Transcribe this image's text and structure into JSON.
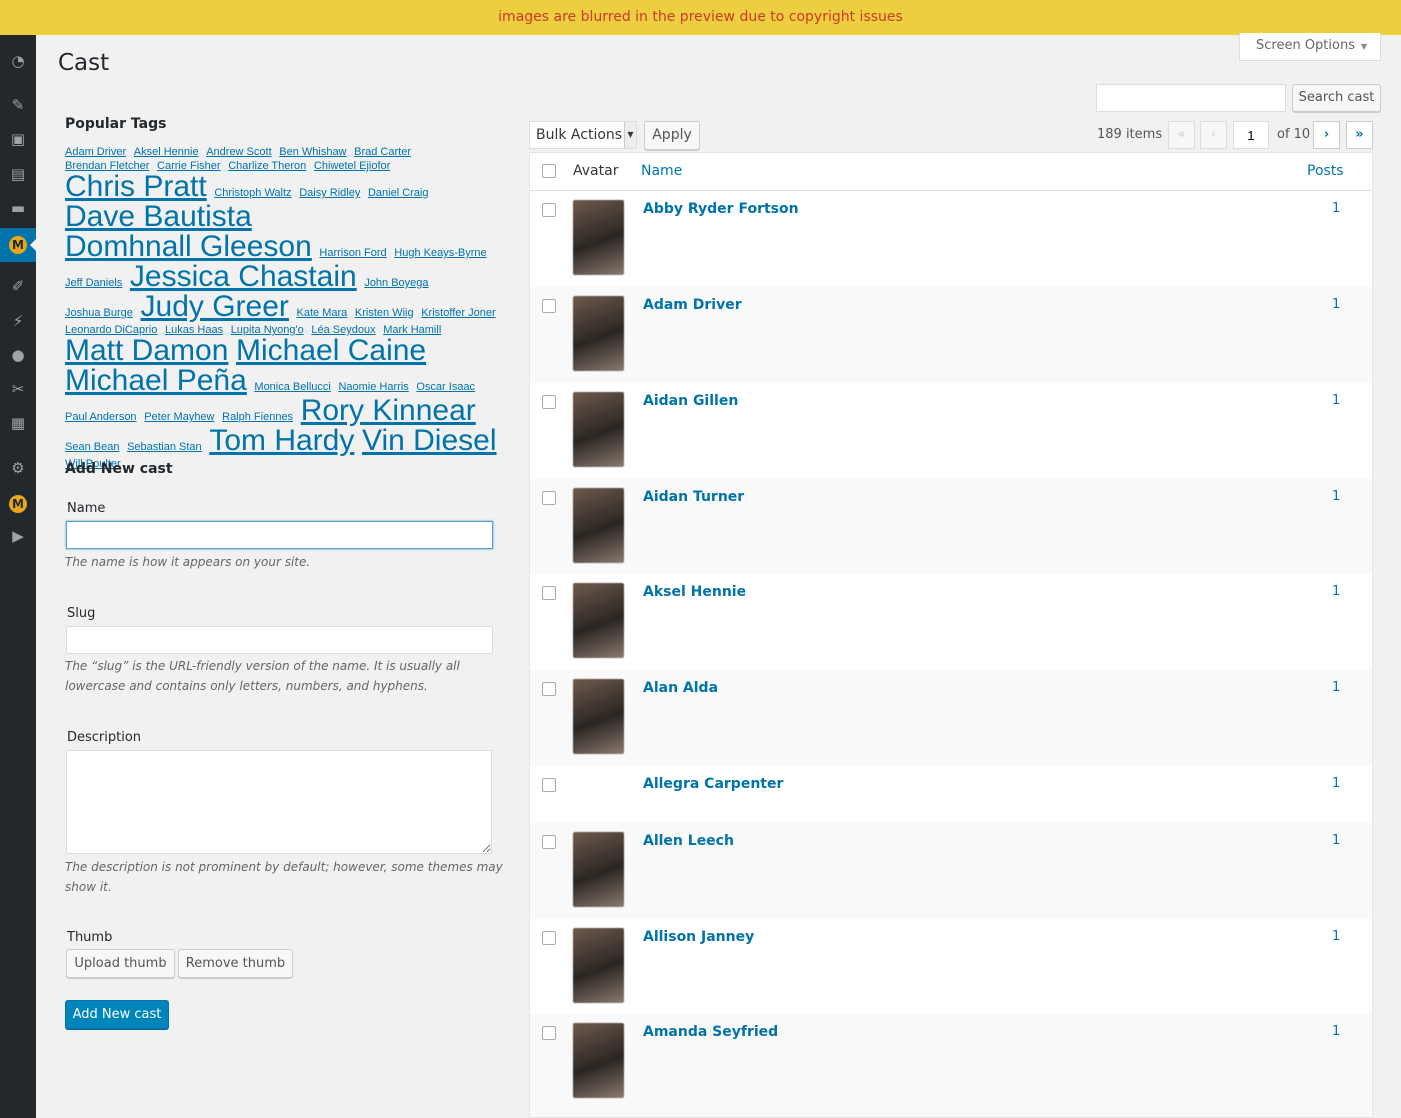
{
  "banner": "images are blurred in the preview due to copyright issues",
  "screen_options": "Screen Options",
  "page_title": "Cast",
  "search": {
    "placeholder": "",
    "button": "Search cast"
  },
  "popular_tags": {
    "title": "Popular Tags",
    "tags": [
      {
        "label": "Adam Driver",
        "size": "small"
      },
      {
        "label": "Aksel Hennie",
        "size": "small"
      },
      {
        "label": "Andrew Scott",
        "size": "small"
      },
      {
        "label": "Ben Whishaw",
        "size": "small"
      },
      {
        "label": "Brad Carter",
        "size": "small"
      },
      {
        "label": "Brendan Fletcher",
        "size": "small"
      },
      {
        "label": "Carrie Fisher",
        "size": "small"
      },
      {
        "label": "Charlize Theron",
        "size": "small"
      },
      {
        "label": "Chiwetel Ejiofor",
        "size": "small"
      },
      {
        "label": "Chris Pratt",
        "size": "large"
      },
      {
        "label": "Christoph Waltz",
        "size": "small"
      },
      {
        "label": "Daisy Ridley",
        "size": "small"
      },
      {
        "label": "Daniel Craig",
        "size": "small"
      },
      {
        "label": "Dave Bautista",
        "size": "large"
      },
      {
        "label": "Domhnall Gleeson",
        "size": "large"
      },
      {
        "label": "Harrison Ford",
        "size": "small"
      },
      {
        "label": "Hugh Keays-Byrne",
        "size": "small"
      },
      {
        "label": "Jeff Daniels",
        "size": "small"
      },
      {
        "label": "Jessica Chastain",
        "size": "large"
      },
      {
        "label": "John Boyega",
        "size": "small"
      },
      {
        "label": "Joshua Burge",
        "size": "small"
      },
      {
        "label": "Judy Greer",
        "size": "large"
      },
      {
        "label": "Kate Mara",
        "size": "small"
      },
      {
        "label": "Kristen Wiig",
        "size": "small"
      },
      {
        "label": "Kristoffer Joner",
        "size": "small"
      },
      {
        "label": "Leonardo DiCaprio",
        "size": "small"
      },
      {
        "label": "Lukas Haas",
        "size": "small"
      },
      {
        "label": "Lupita Nyong'o",
        "size": "small"
      },
      {
        "label": "Léa Seydoux",
        "size": "small"
      },
      {
        "label": "Mark Hamill",
        "size": "small"
      },
      {
        "label": "Matt Damon",
        "size": "large"
      },
      {
        "label": "Michael Caine",
        "size": "large"
      },
      {
        "label": "Michael Peña",
        "size": "large"
      },
      {
        "label": "Monica Bellucci",
        "size": "small"
      },
      {
        "label": "Naomie Harris",
        "size": "small"
      },
      {
        "label": "Oscar Isaac",
        "size": "small"
      },
      {
        "label": "Paul Anderson",
        "size": "small"
      },
      {
        "label": "Peter Mayhew",
        "size": "small"
      },
      {
        "label": "Ralph Fiennes",
        "size": "small"
      },
      {
        "label": "Rory Kinnear",
        "size": "large"
      },
      {
        "label": "Sean Bean",
        "size": "small"
      },
      {
        "label": "Sebastian Stan",
        "size": "small"
      },
      {
        "label": "Tom Hardy",
        "size": "large"
      },
      {
        "label": "Vin Diesel",
        "size": "large"
      },
      {
        "label": "Will Poulter",
        "size": "small"
      }
    ]
  },
  "add_form": {
    "title": "Add New cast",
    "name_label": "Name",
    "name_value": "",
    "name_help": "The name is how it appears on your site.",
    "slug_label": "Slug",
    "slug_value": "",
    "slug_help": "The “slug” is the URL-friendly version of the name. It is usually all lowercase and contains only letters, numbers, and hyphens.",
    "description_label": "Description",
    "description_value": "",
    "description_help": "The description is not prominent by default; however, some themes may show it.",
    "thumb_label": "Thumb",
    "upload_button": "Upload thumb",
    "remove_button": "Remove thumb",
    "submit_button": "Add New cast"
  },
  "list": {
    "bulk_actions": "Bulk Actions",
    "apply": "Apply",
    "items_count": "189 items",
    "pagination": {
      "first": "«",
      "prev": "‹",
      "current": "1",
      "of": "of 10",
      "next": "›",
      "last": "»"
    },
    "columns": {
      "avatar": "Avatar",
      "name": "Name",
      "posts": "Posts"
    },
    "rows": [
      {
        "name": "Abby Ryder Fortson",
        "posts": "1",
        "has_avatar": true
      },
      {
        "name": "Adam Driver",
        "posts": "1",
        "has_avatar": true
      },
      {
        "name": "Aidan Gillen",
        "posts": "1",
        "has_avatar": true
      },
      {
        "name": "Aidan Turner",
        "posts": "1",
        "has_avatar": true
      },
      {
        "name": "Aksel Hennie",
        "posts": "1",
        "has_avatar": true
      },
      {
        "name": "Alan Alda",
        "posts": "1",
        "has_avatar": true
      },
      {
        "name": "Allegra Carpenter",
        "posts": "1",
        "has_avatar": false
      },
      {
        "name": "Allen Leech",
        "posts": "1",
        "has_avatar": true
      },
      {
        "name": "Allison Janney",
        "posts": "1",
        "has_avatar": true
      },
      {
        "name": "Amanda Seyfried",
        "posts": "1",
        "has_avatar": true
      }
    ]
  },
  "colors": {
    "accent": "#0073aa",
    "banner_bg": "#eccf3f",
    "banner_text": "#d0392b",
    "sidebar_bg": "#23282d"
  }
}
